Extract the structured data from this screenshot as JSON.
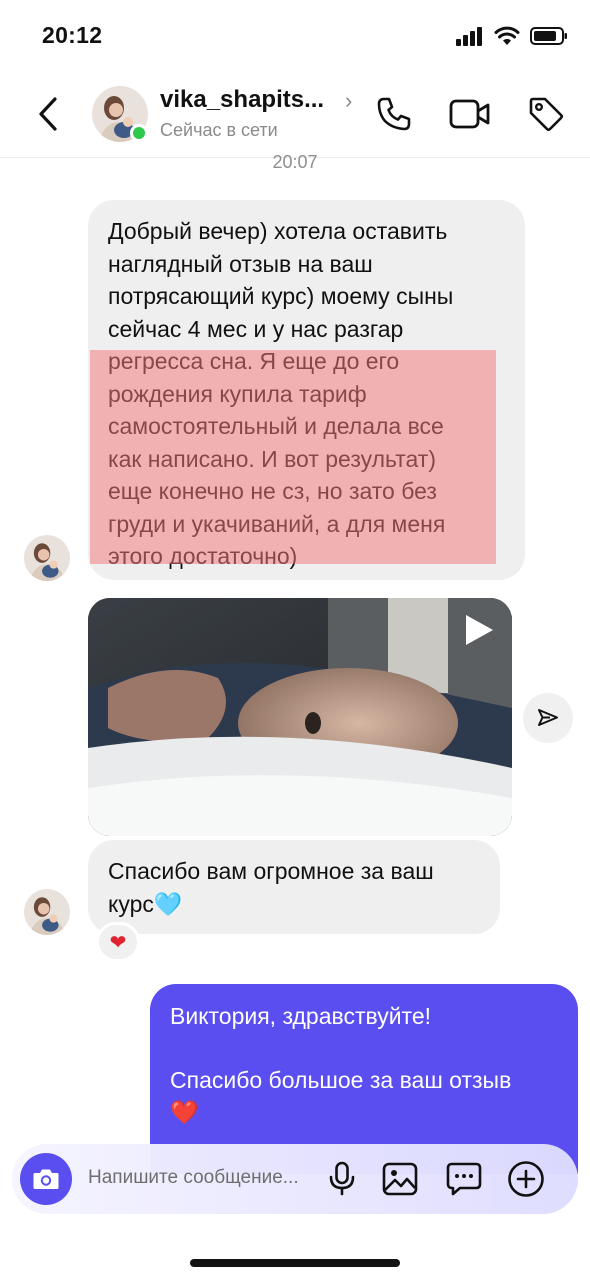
{
  "status_bar": {
    "time": "20:12"
  },
  "header": {
    "username": "vika_shapits...",
    "presence": "Сейчас в сети"
  },
  "conversation": {
    "timestamp": "20:07",
    "message1": {
      "lines": [
        "Добрый вечер) хотела оставить",
        "наглядный отзыв на ваш",
        "потрясающий курс) моему сыны",
        "сейчас 4 мес и у нас разгар",
        "регресса сна. Я еще до его",
        "рождения купила тариф",
        "самостоятельный и делала все",
        "как написано. И вот результат)",
        "еще конечно не сз, но зато без",
        "груди и укачиваний, а для меня",
        "этого достаточно)"
      ]
    },
    "message2": {
      "lines": [
        "Спасибо вам огромное за ваш",
        "курс🩵"
      ]
    },
    "reaction": "❤",
    "outgoing": {
      "line1": "Виктория, здравствуйте!",
      "line2": "Спасибо большое за ваш отзыв",
      "line3": "❤️"
    }
  },
  "composer": {
    "placeholder": "Напишите сообщение..."
  },
  "colors": {
    "accent": "#5b4ef0",
    "incoming_bubble": "#efefef",
    "highlight": "#f2787d",
    "online": "#2ec94b"
  },
  "icons": [
    "back-chevron-icon",
    "phone-icon",
    "video-call-icon",
    "tag-icon",
    "play-icon",
    "share-icon",
    "camera-icon",
    "microphone-icon",
    "gallery-icon",
    "sticker-icon",
    "plus-icon"
  ]
}
